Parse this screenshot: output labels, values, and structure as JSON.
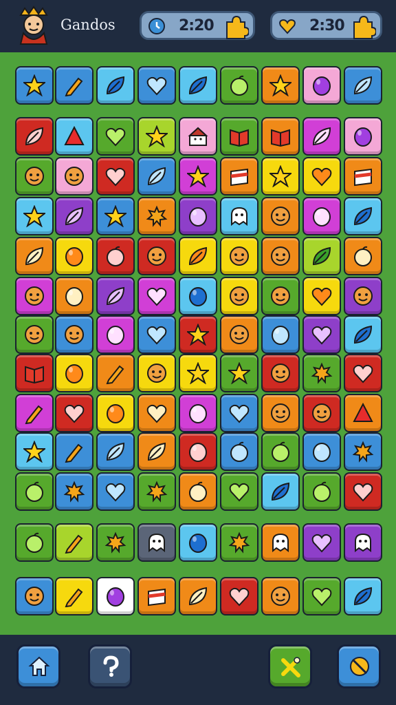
{
  "header": {
    "title": "Gandos",
    "timer1": "2:20",
    "timer2": "2:30"
  },
  "colors": {
    "board": "#4ea23b",
    "bar": "#1f2b3f"
  },
  "tile_palette": {
    "R": "#cf2a22",
    "O": "#f08a18",
    "Y": "#f6d90e",
    "G": "#56a92c",
    "L": "#a8d52c",
    "B": "#3d8fd8",
    "C": "#5cc6ef",
    "P": "#8e3fc9",
    "M": "#d13fd6",
    "K": "#f4a8d6",
    "S": "#5b6578",
    "W": "#ffffff"
  },
  "board_rows": [
    [
      "B:star",
      "B:pencil",
      "C:leaf",
      "B:heart",
      "C:leaf",
      "G:apple",
      "O:star",
      "K:drop",
      "B:leaf"
    ],
    [
      "R:leaf",
      "C:triangle",
      "G:heart",
      "L:star",
      "K:house",
      "G:book",
      "O:book",
      "M:leaf",
      "K:drop"
    ],
    [
      "G:face",
      "K:face",
      "R:heart",
      "B:leaf",
      "M:star",
      "O:box",
      "Y:star",
      "Y:heart",
      "O:box"
    ],
    [
      "C:star",
      "P:leaf",
      "B:star",
      "O:flower",
      "P:drop",
      "C:ghost",
      "O:face",
      "M:drop",
      "C:leaf"
    ],
    [
      "O:leaf",
      "Y:drop",
      "R:apple",
      "R:face",
      "Y:leaf",
      "Y:face",
      "O:face",
      "L:leaf",
      "O:apple"
    ],
    [
      "M:face",
      "O:drop",
      "P:leaf",
      "M:heart",
      "C:drop",
      "Y:face",
      "G:face",
      "Y:heart",
      "P:face"
    ],
    [
      "G:face",
      "B:face",
      "M:drop",
      "B:heart",
      "R:star",
      "O:face",
      "B:drop",
      "P:heart",
      "C:leaf"
    ],
    [
      "R:book",
      "Y:drop",
      "O:pencil",
      "Y:face",
      "Y:star",
      "G:star",
      "R:face",
      "G:flower",
      "R:heart"
    ],
    [
      "M:pencil",
      "R:heart",
      "Y:drop",
      "O:heart",
      "M:drop",
      "B:heart",
      "O:face",
      "R:face",
      "O:triangle"
    ],
    [
      "C:star",
      "B:pencil",
      "B:leaf",
      "O:leaf",
      "R:drop",
      "B:apple",
      "G:apple",
      "B:drop",
      "B:flower"
    ],
    [
      "G:apple",
      "B:flower",
      "B:heart",
      "G:flower",
      "O:apple",
      "G:heart",
      "C:leaf",
      "G:apple",
      "R:heart"
    ],
    [
      "G:apple",
      "L:pencil",
      "G:flower",
      "S:ghost",
      "C:drop",
      "G:flower",
      "O:ghost",
      "P:heart",
      "P:ghost"
    ],
    [
      "B:face",
      "Y:pencil",
      "W:drop",
      "O:box",
      "O:leaf",
      "R:heart",
      "O:face",
      "G:heart",
      "C:leaf"
    ]
  ],
  "footer": {
    "home_icon": "home-icon",
    "help_icon": "question-icon",
    "hint_icon": "wand-icon",
    "settings_icon": "no-sound-icon"
  }
}
